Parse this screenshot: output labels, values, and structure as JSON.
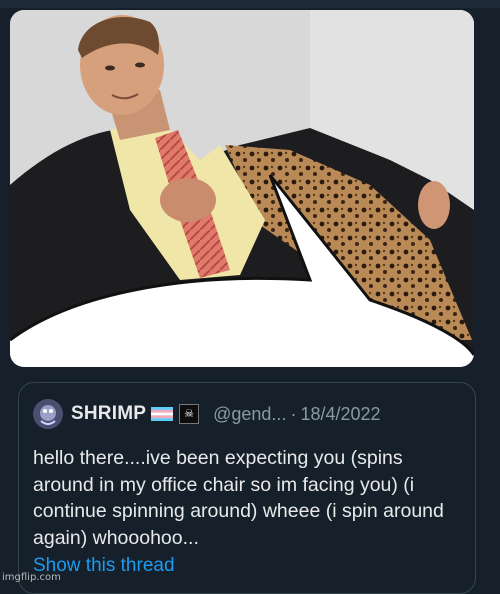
{
  "tweet": {
    "display_name": "SHRIMP",
    "handle": "@gend...",
    "separator": "·",
    "date": "18/4/2022",
    "text": "hello there....ive been expecting you (spins around in my office chair so im facing you) (i continue spinning around) wheee (i spin around again) whooohoo...",
    "show_thread_label": "Show this thread",
    "badges": [
      "trans-flag-icon",
      "pirate-flag-icon"
    ]
  },
  "watermark": "imgflip.com",
  "colors": {
    "background": "#15202b",
    "border": "#38444d",
    "text_primary": "#e7e9ea",
    "text_secondary": "#8b98a5",
    "link": "#1d9bf0"
  }
}
